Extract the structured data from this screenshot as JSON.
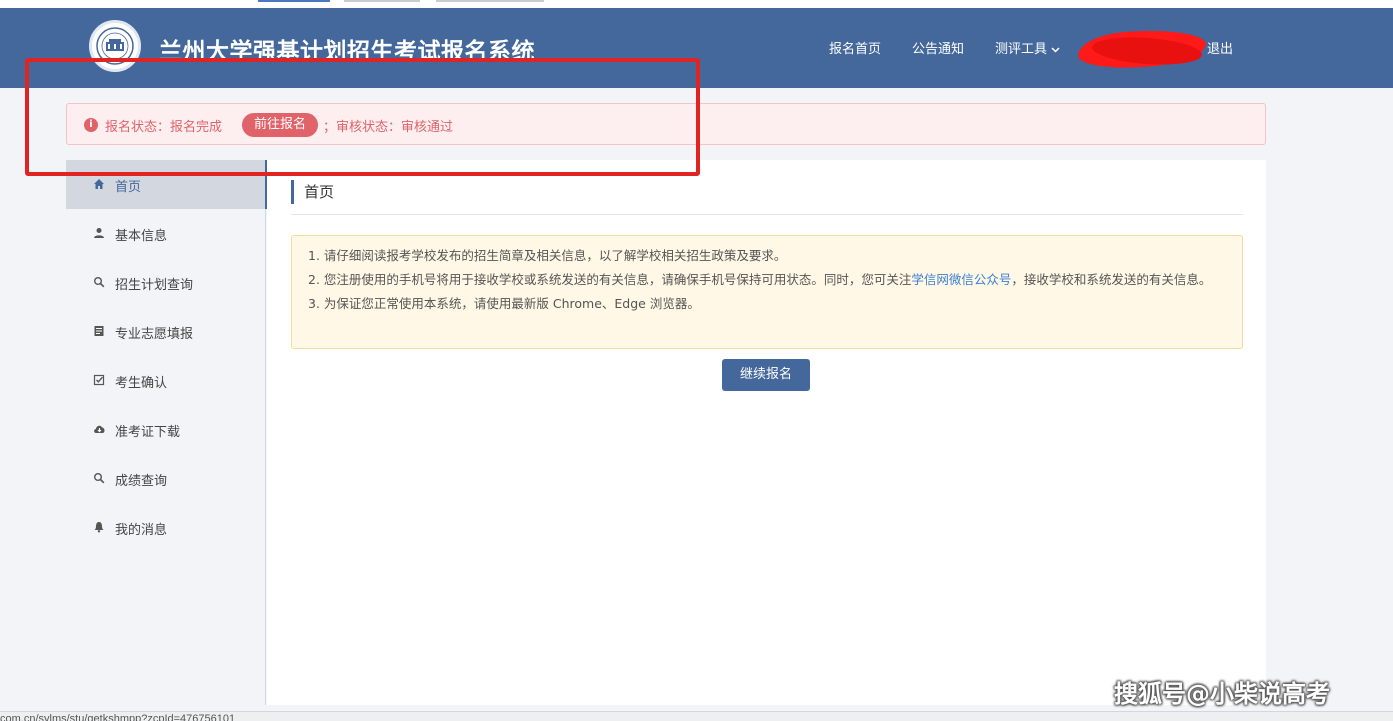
{
  "header": {
    "title": "兰州大学强基计划招生考试报名系统",
    "nav": [
      {
        "label": "报名首页"
      },
      {
        "label": "公告通知"
      },
      {
        "label": "测评工具"
      },
      {
        "label": "退出"
      }
    ]
  },
  "alert": {
    "status_text": "报名状态：报名完成",
    "button": "前往报名",
    "review_text": "；审核状态：审核通过"
  },
  "sidebar": {
    "items": [
      {
        "label": "首页",
        "icon": "home-icon"
      },
      {
        "label": "基本信息",
        "icon": "user-icon"
      },
      {
        "label": "招生计划查询",
        "icon": "search-icon"
      },
      {
        "label": "专业志愿填报",
        "icon": "form-icon"
      },
      {
        "label": "考生确认",
        "icon": "checkbox-icon"
      },
      {
        "label": "准考证下载",
        "icon": "cloud-download-icon"
      },
      {
        "label": "成绩查询",
        "icon": "search-icon"
      },
      {
        "label": "我的消息",
        "icon": "bell-icon"
      }
    ]
  },
  "main": {
    "title": "首页",
    "notice": {
      "line1": "1. 请仔细阅读报考学校发布的招生简章及相关信息，以了解学校相关招生政策及要求。",
      "line2_a": "2. 您注册使用的手机号将用于接收学校或系统发送的有关信息，请确保手机号保持可用状态。同时，您可关注",
      "line2_link": "学信网微信公众号",
      "line2_b": "，接收学校和系统发送的有关信息。",
      "line3": "3. 为保证您正常使用本系统，请使用最新版 Chrome、Edge 浏览器。"
    },
    "continue_button": "继续报名"
  },
  "watermark": "搜狐号@小柴说高考",
  "statusbar": {
    "url": "com.cn/sylms/stu/getkshmpp?zcpId=476756101"
  },
  "colors": {
    "header_bg": "#44689b",
    "alert_text": "#e0636a",
    "annotation": "#e02424"
  }
}
